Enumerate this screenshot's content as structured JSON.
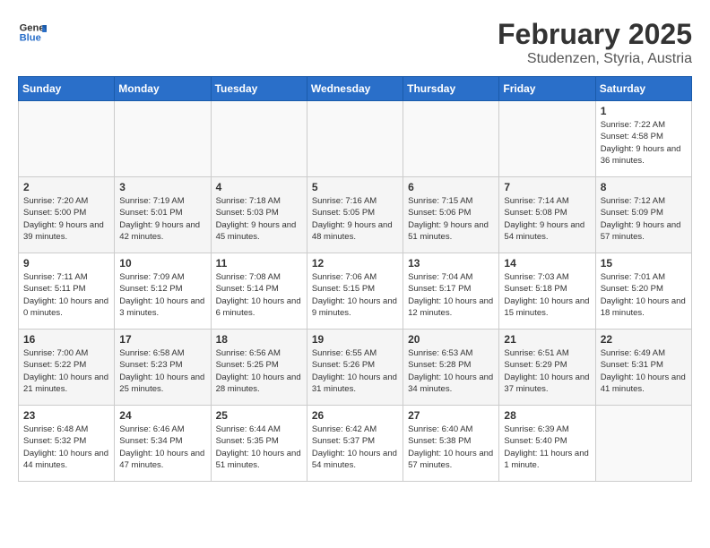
{
  "logo": {
    "line1": "General",
    "line2": "Blue"
  },
  "title": "February 2025",
  "location": "Studenzen, Styria, Austria",
  "days_of_week": [
    "Sunday",
    "Monday",
    "Tuesday",
    "Wednesday",
    "Thursday",
    "Friday",
    "Saturday"
  ],
  "weeks": [
    [
      {
        "day": "",
        "info": ""
      },
      {
        "day": "",
        "info": ""
      },
      {
        "day": "",
        "info": ""
      },
      {
        "day": "",
        "info": ""
      },
      {
        "day": "",
        "info": ""
      },
      {
        "day": "",
        "info": ""
      },
      {
        "day": "1",
        "info": "Sunrise: 7:22 AM\nSunset: 4:58 PM\nDaylight: 9 hours and 36 minutes."
      }
    ],
    [
      {
        "day": "2",
        "info": "Sunrise: 7:20 AM\nSunset: 5:00 PM\nDaylight: 9 hours and 39 minutes."
      },
      {
        "day": "3",
        "info": "Sunrise: 7:19 AM\nSunset: 5:01 PM\nDaylight: 9 hours and 42 minutes."
      },
      {
        "day": "4",
        "info": "Sunrise: 7:18 AM\nSunset: 5:03 PM\nDaylight: 9 hours and 45 minutes."
      },
      {
        "day": "5",
        "info": "Sunrise: 7:16 AM\nSunset: 5:05 PM\nDaylight: 9 hours and 48 minutes."
      },
      {
        "day": "6",
        "info": "Sunrise: 7:15 AM\nSunset: 5:06 PM\nDaylight: 9 hours and 51 minutes."
      },
      {
        "day": "7",
        "info": "Sunrise: 7:14 AM\nSunset: 5:08 PM\nDaylight: 9 hours and 54 minutes."
      },
      {
        "day": "8",
        "info": "Sunrise: 7:12 AM\nSunset: 5:09 PM\nDaylight: 9 hours and 57 minutes."
      }
    ],
    [
      {
        "day": "9",
        "info": "Sunrise: 7:11 AM\nSunset: 5:11 PM\nDaylight: 10 hours and 0 minutes."
      },
      {
        "day": "10",
        "info": "Sunrise: 7:09 AM\nSunset: 5:12 PM\nDaylight: 10 hours and 3 minutes."
      },
      {
        "day": "11",
        "info": "Sunrise: 7:08 AM\nSunset: 5:14 PM\nDaylight: 10 hours and 6 minutes."
      },
      {
        "day": "12",
        "info": "Sunrise: 7:06 AM\nSunset: 5:15 PM\nDaylight: 10 hours and 9 minutes."
      },
      {
        "day": "13",
        "info": "Sunrise: 7:04 AM\nSunset: 5:17 PM\nDaylight: 10 hours and 12 minutes."
      },
      {
        "day": "14",
        "info": "Sunrise: 7:03 AM\nSunset: 5:18 PM\nDaylight: 10 hours and 15 minutes."
      },
      {
        "day": "15",
        "info": "Sunrise: 7:01 AM\nSunset: 5:20 PM\nDaylight: 10 hours and 18 minutes."
      }
    ],
    [
      {
        "day": "16",
        "info": "Sunrise: 7:00 AM\nSunset: 5:22 PM\nDaylight: 10 hours and 21 minutes."
      },
      {
        "day": "17",
        "info": "Sunrise: 6:58 AM\nSunset: 5:23 PM\nDaylight: 10 hours and 25 minutes."
      },
      {
        "day": "18",
        "info": "Sunrise: 6:56 AM\nSunset: 5:25 PM\nDaylight: 10 hours and 28 minutes."
      },
      {
        "day": "19",
        "info": "Sunrise: 6:55 AM\nSunset: 5:26 PM\nDaylight: 10 hours and 31 minutes."
      },
      {
        "day": "20",
        "info": "Sunrise: 6:53 AM\nSunset: 5:28 PM\nDaylight: 10 hours and 34 minutes."
      },
      {
        "day": "21",
        "info": "Sunrise: 6:51 AM\nSunset: 5:29 PM\nDaylight: 10 hours and 37 minutes."
      },
      {
        "day": "22",
        "info": "Sunrise: 6:49 AM\nSunset: 5:31 PM\nDaylight: 10 hours and 41 minutes."
      }
    ],
    [
      {
        "day": "23",
        "info": "Sunrise: 6:48 AM\nSunset: 5:32 PM\nDaylight: 10 hours and 44 minutes."
      },
      {
        "day": "24",
        "info": "Sunrise: 6:46 AM\nSunset: 5:34 PM\nDaylight: 10 hours and 47 minutes."
      },
      {
        "day": "25",
        "info": "Sunrise: 6:44 AM\nSunset: 5:35 PM\nDaylight: 10 hours and 51 minutes."
      },
      {
        "day": "26",
        "info": "Sunrise: 6:42 AM\nSunset: 5:37 PM\nDaylight: 10 hours and 54 minutes."
      },
      {
        "day": "27",
        "info": "Sunrise: 6:40 AM\nSunset: 5:38 PM\nDaylight: 10 hours and 57 minutes."
      },
      {
        "day": "28",
        "info": "Sunrise: 6:39 AM\nSunset: 5:40 PM\nDaylight: 11 hours and 1 minute."
      },
      {
        "day": "",
        "info": ""
      }
    ]
  ]
}
